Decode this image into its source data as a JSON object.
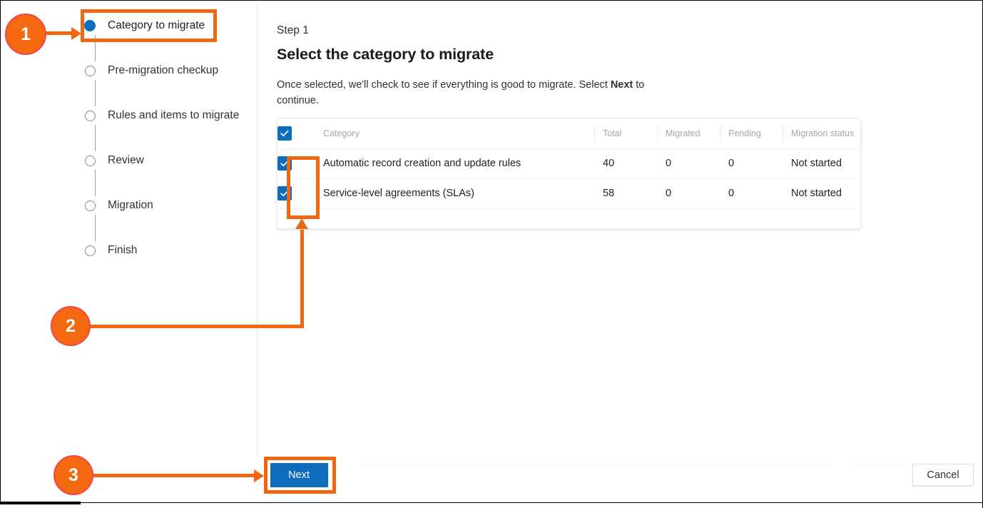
{
  "stepper": {
    "steps": [
      {
        "label": "Category to migrate",
        "state": "active"
      },
      {
        "label": "Pre-migration checkup",
        "state": "pending"
      },
      {
        "label": "Rules and items to migrate",
        "state": "pending"
      },
      {
        "label": "Review",
        "state": "pending"
      },
      {
        "label": "Migration",
        "state": "pending"
      },
      {
        "label": "Finish",
        "state": "pending"
      }
    ]
  },
  "main": {
    "eyebrow": "Step 1",
    "title": "Select the category to migrate",
    "description_before": "Once selected, we'll check to see if everything is good to migrate. Select ",
    "description_bold": "Next",
    "description_after": " to continue."
  },
  "table": {
    "columns": [
      "Category",
      "Total",
      "Migrated",
      "Pending",
      "Migration status"
    ],
    "header_checkbox_checked": true,
    "rows": [
      {
        "checked": true,
        "category": "Automatic record creation and update rules",
        "total": "40",
        "migrated": "0",
        "pending": "0",
        "status": "Not started"
      },
      {
        "checked": true,
        "category": "Service-level agreements (SLAs)",
        "total": "58",
        "migrated": "0",
        "pending": "0",
        "status": "Not started"
      }
    ]
  },
  "footer": {
    "next_label": "Next",
    "cancel_label": "Cancel"
  },
  "annotations": {
    "badges": [
      {
        "number": "1",
        "target": "Category to migrate step"
      },
      {
        "number": "2",
        "target": "Row checkboxes"
      },
      {
        "number": "3",
        "target": "Next button"
      }
    ],
    "accent_color": "#ef6712",
    "badge_fill": "#f4690f",
    "badge_ring": "#f0454a"
  },
  "colors": {
    "primary_blue": "#0f6cbd",
    "text_primary": "#201f1e",
    "text_secondary": "#323130",
    "header_grey": "#a6a6a6"
  }
}
